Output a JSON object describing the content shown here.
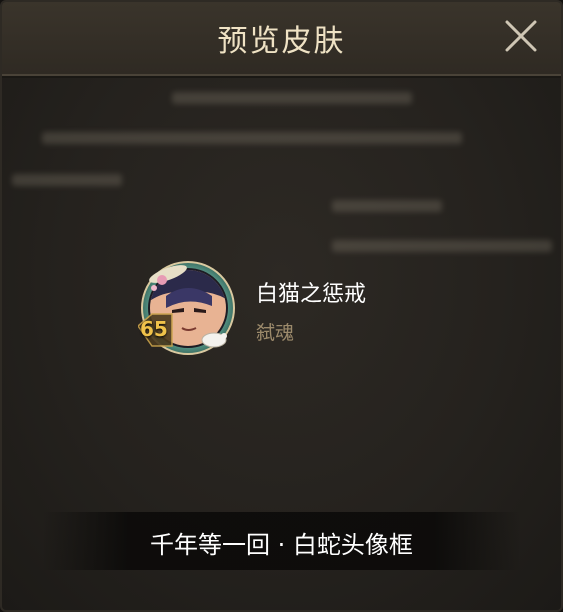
{
  "dialog": {
    "title": "预览皮肤",
    "close_icon": "close-icon"
  },
  "item": {
    "level": "65",
    "name": "白猫之惩戒",
    "subtitle": "弑魂",
    "avatar_icon": "character-avatar-frame"
  },
  "footer": {
    "label": "千年等一回 · 白蛇头像框"
  },
  "colors": {
    "title_text": "#efe2c4",
    "level_text": "#f0c24a",
    "subtitle_text": "#9c8a6b",
    "background": "#25221e"
  }
}
